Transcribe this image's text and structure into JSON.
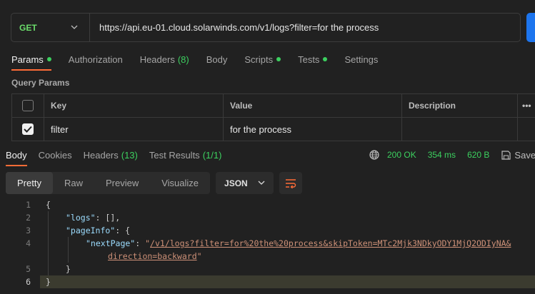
{
  "request": {
    "method": "GET",
    "url": "https://api.eu-01.cloud.solarwinds.com/v1/logs?filter=for the process"
  },
  "request_tabs": [
    {
      "label": "Params",
      "dot": true
    },
    {
      "label": "Authorization"
    },
    {
      "label": "Headers",
      "count": "(8)"
    },
    {
      "label": "Body"
    },
    {
      "label": "Scripts",
      "dot": true
    },
    {
      "label": "Tests",
      "dot": true
    },
    {
      "label": "Settings"
    }
  ],
  "query_params": {
    "title": "Query Params",
    "headers": {
      "key": "Key",
      "value": "Value",
      "description": "Description",
      "more": "•••"
    },
    "rows": [
      {
        "checked": true,
        "key": "filter",
        "value": "for the process",
        "description": ""
      }
    ]
  },
  "response_tabs": [
    {
      "label": "Body"
    },
    {
      "label": "Cookies"
    },
    {
      "label": "Headers",
      "count": "(13)"
    },
    {
      "label": "Test Results",
      "count": "(1/1)"
    }
  ],
  "response_meta": {
    "status": "200 OK",
    "time": "354 ms",
    "size": "620 B",
    "save_label": "Save"
  },
  "view_modes": [
    "Pretty",
    "Raw",
    "Preview",
    "Visualize"
  ],
  "format": "JSON",
  "code_lines": {
    "l1": "{",
    "l2_key": "\"logs\"",
    "l2_rest": ": [],",
    "l3_key": "\"pageInfo\"",
    "l3_rest": ": {",
    "l4_key": "\"nextPage\"",
    "l4_sep": ": ",
    "l4_q": "\"",
    "l4_link1": "/v1/logs?filter=for%20the%20process&skipToken=MTc2Mjk3NDkyODY1MjQ2ODIyNA&",
    "l4b_link2": "direction=backward",
    "l4b_q": "\"",
    "l5": "}",
    "l6": "}"
  },
  "colors": {
    "accent": "#ff6c37",
    "success": "#3cd05f",
    "method": "#6bdd6b",
    "send": "#1d75ee"
  }
}
